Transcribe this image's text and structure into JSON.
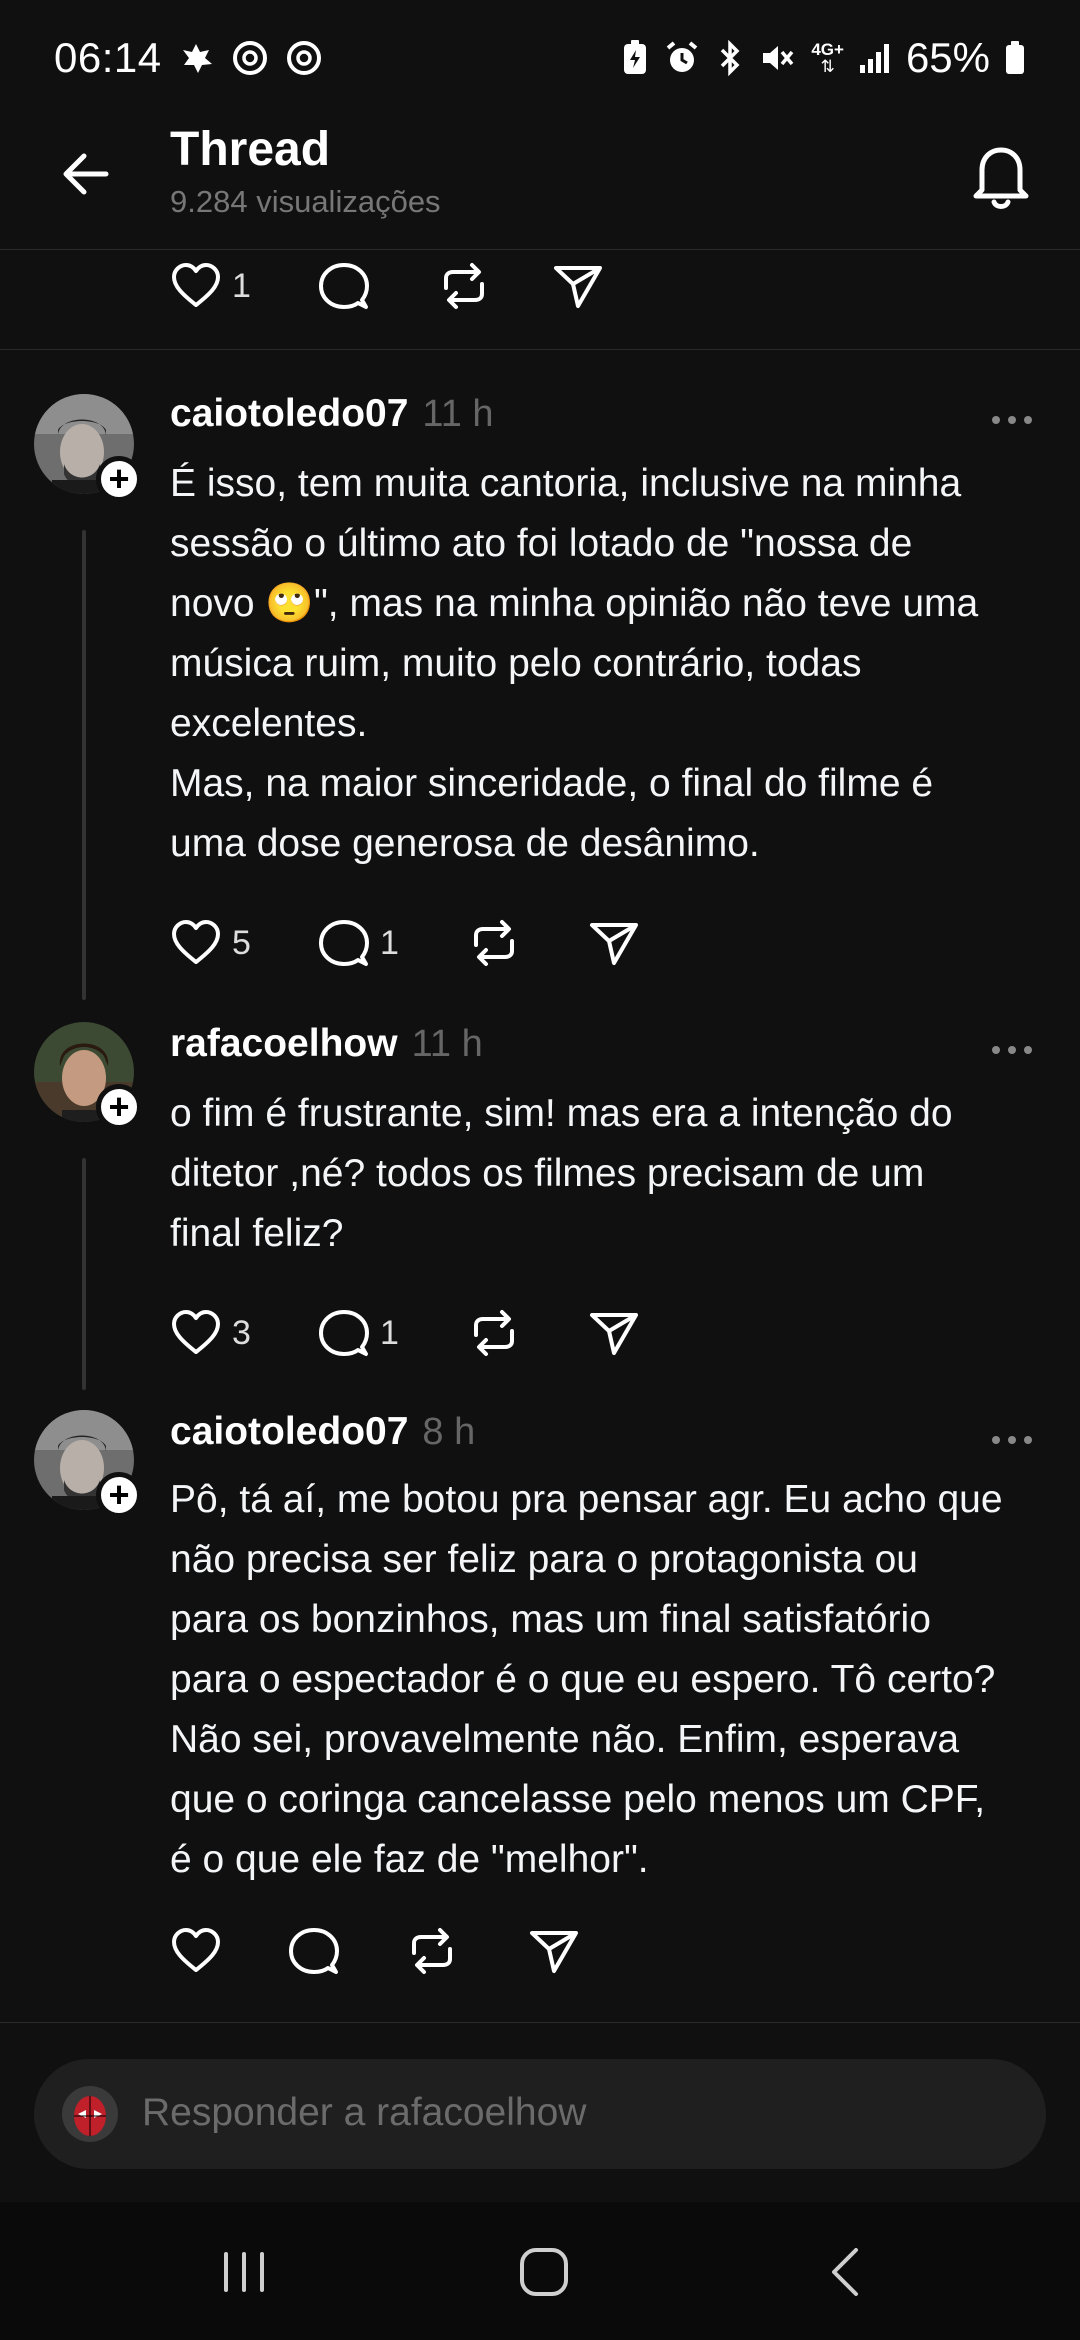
{
  "status_bar": {
    "time": "06:14",
    "network": "4G+",
    "battery": "65%"
  },
  "header": {
    "title": "Thread",
    "views": "9.284 visualizações"
  },
  "previous_post": {
    "likes": "1"
  },
  "posts": [
    {
      "username": "caiotoledo07",
      "time": "11 h",
      "text": "É isso, tem muita cantoria, inclusive na minha\nsessão o último ato foi lotado de \"nossa de\nnovo 🙄\", mas na minha opinião não teve uma\nmúsica ruim, muito pelo contrário, todas\nexcelentes.\nMas, na maior sinceridade, o final do filme é\numa dose generosa de desânimo.",
      "likes": "5",
      "comments": "1"
    },
    {
      "username": "rafacoelhow",
      "time": "11 h",
      "text": "o fim é frustrante, sim! mas era a intenção do\nditetor ,né? todos os filmes precisam de um\nfinal feliz?",
      "likes": "3",
      "comments": "1"
    },
    {
      "username": "caiotoledo07",
      "time": "8 h",
      "text": "Pô, tá aí, me botou pra pensar agr. Eu acho que\nnão precisa ser feliz para o protagonista ou\npara os bonzinhos, mas um final satisfatório\npara o espectador é o que eu espero. Tô certo?\nNão sei, provavelmente não. Enfim, esperava\nque o coringa cancelasse pelo menos um CPF,\né o que ele faz de \"melhor\".",
      "likes": "",
      "comments": ""
    }
  ],
  "reply": {
    "placeholder": "Responder a rafacoelhow"
  },
  "icons": {
    "back": "arrow-left-icon",
    "bell": "bell-icon",
    "like": "heart-icon",
    "comment": "comment-bubble-icon",
    "repost": "repost-icon",
    "share": "send-icon",
    "more": "more-dots-icon"
  },
  "colors": {
    "background": "#101010",
    "text": "#f3f5f7",
    "muted": "#777777",
    "reply_pill": "#1f1f1f"
  }
}
